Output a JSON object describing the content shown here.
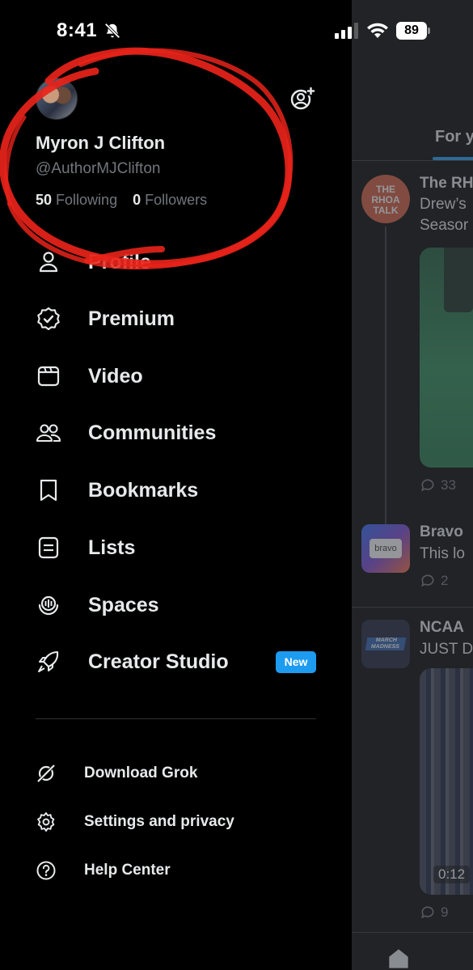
{
  "status_bar": {
    "time": "8:41",
    "battery": "89",
    "icons": [
      "bell-off-icon",
      "signal-icon",
      "wifi-icon",
      "battery-icon"
    ]
  },
  "drawer": {
    "profile": {
      "display_name": "Myron J Clifton",
      "handle": "@AuthorMJClifton",
      "following_count": "50",
      "following_label": "Following",
      "followers_count": "0",
      "followers_label": "Followers"
    },
    "nav_items": [
      {
        "label": "Profile",
        "icon": "person-icon"
      },
      {
        "label": "Premium",
        "icon": "verified-badge-icon"
      },
      {
        "label": "Video",
        "icon": "video-icon"
      },
      {
        "label": "Communities",
        "icon": "communities-icon"
      },
      {
        "label": "Bookmarks",
        "icon": "bookmark-icon"
      },
      {
        "label": "Lists",
        "icon": "list-icon"
      },
      {
        "label": "Spaces",
        "icon": "spaces-icon"
      },
      {
        "label": "Creator Studio",
        "icon": "rocket-icon",
        "badge": "New"
      }
    ],
    "secondary_items": [
      {
        "label": "Download Grok",
        "icon": "grok-icon"
      },
      {
        "label": "Settings and privacy",
        "icon": "gear-icon"
      },
      {
        "label": "Help Center",
        "icon": "help-icon"
      }
    ]
  },
  "timeline": {
    "tab_label": "For y",
    "posts": [
      {
        "avatar_text": "THE RHOA TALK",
        "lines": [
          "The RH",
          "Drew’s",
          "Seasor"
        ],
        "reply_count": "33"
      },
      {
        "avatar_text": "bravo",
        "lines": [
          "Bravo",
          "This lo"
        ],
        "reply_count": "2"
      },
      {
        "avatar_text": "MARCH MADNESS",
        "lines": [
          "NCAA",
          "JUST D"
        ],
        "video_time": "0:12",
        "reply_count": "9"
      }
    ]
  },
  "colors": {
    "background": "#000000",
    "text_primary": "#e7e9ea",
    "text_secondary": "#71767b",
    "accent": "#1d9bf0",
    "annotation": "#e8231a"
  }
}
